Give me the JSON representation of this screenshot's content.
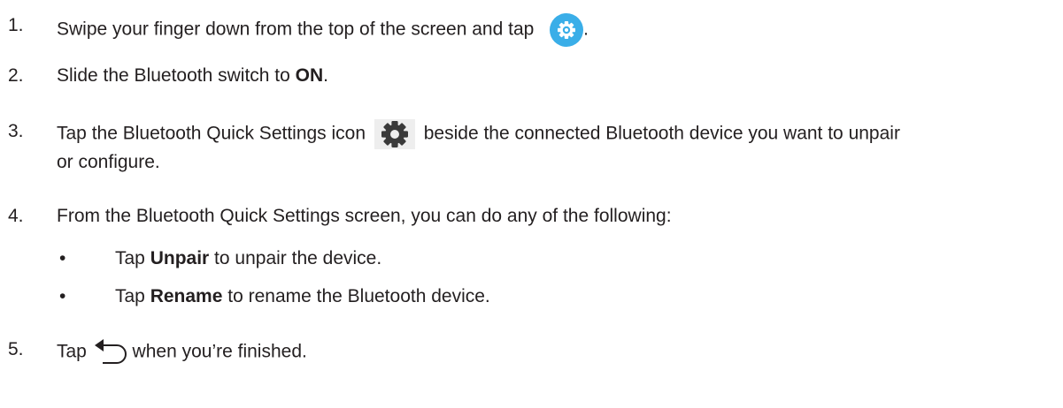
{
  "steps": [
    {
      "number": "1.",
      "text_before": "Swipe your finger down from the top of the screen and tap",
      "icon": "settings-gear-circle-icon",
      "text_after": "."
    },
    {
      "number": "2.",
      "text_before": "Slide the Bluetooth switch to ",
      "bold": "ON",
      "text_after": "."
    },
    {
      "number": "3.",
      "text_before": "Tap the Bluetooth Quick Settings icon",
      "icon": "gear-icon",
      "text_after": "beside the connected Bluetooth device you want to unpair",
      "text_line2": "or configure."
    },
    {
      "number": "4.",
      "text": "From the Bluetooth Quick Settings screen, you can do any of the following:"
    },
    {
      "number": "5.",
      "text_before": "Tap",
      "icon": "back-arrow-icon",
      "text_after": "when you’re finished."
    }
  ],
  "bullets": [
    {
      "marker": "•",
      "prefix": "Tap ",
      "bold": "Unpair",
      "suffix": " to unpair the device."
    },
    {
      "marker": "•",
      "prefix": "Tap ",
      "bold": "Rename",
      "suffix": " to rename the Bluetooth device."
    }
  ],
  "colors": {
    "text": "#231f20",
    "settings_circle": "#3aaee8",
    "gear": "#3a3a3a"
  }
}
